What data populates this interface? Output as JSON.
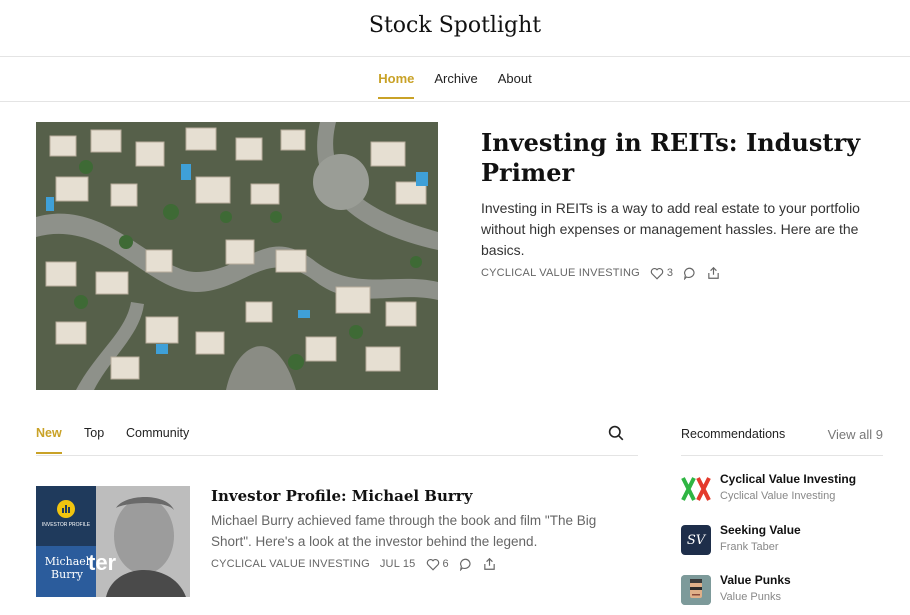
{
  "publication": {
    "title": "Stock Spotlight"
  },
  "nav": {
    "items": [
      "Home",
      "Archive",
      "About"
    ],
    "active": "Home"
  },
  "featured": {
    "title": "Investing in REITs: Industry Primer",
    "subtitle": "Investing in REITs is a way to add real estate to your portfolio without high expenses or management hassles. Here are the basics.",
    "publication_label": "CYCLICAL VALUE INVESTING",
    "likes": "3",
    "image_icon": "aerial-neighborhood-photo"
  },
  "feed": {
    "tabs": [
      "New",
      "Top",
      "Community"
    ],
    "active_tab": "New",
    "posts": [
      {
        "title": "Investor Profile: Michael Burry",
        "subtitle": "Michael Burry achieved fame through the book and film \"The Big Short\". Here's a look at the investor behind the legend.",
        "publication_label": "CYCLICAL VALUE INVESTING",
        "date": "JUL 15",
        "likes": "6",
        "thumb": {
          "badge": "INVESTOR PROFILE",
          "name": "Michael Burry",
          "partial_text": "ter"
        }
      }
    ]
  },
  "recommendations": {
    "heading": "Recommendations",
    "view_all": "View all 9",
    "items": [
      {
        "name": "Cyclical Value Investing",
        "author": "Cyclical Value Investing",
        "logo": "xx-logo-icon"
      },
      {
        "name": "Seeking Value",
        "author": "Frank Taber",
        "logo_text": "SV"
      },
      {
        "name": "Value Punks",
        "author": "Value Punks",
        "logo": "punk-avatar-icon"
      }
    ]
  },
  "colors": {
    "accent": "#c9a227",
    "text": "#222222",
    "muted": "#666666"
  }
}
